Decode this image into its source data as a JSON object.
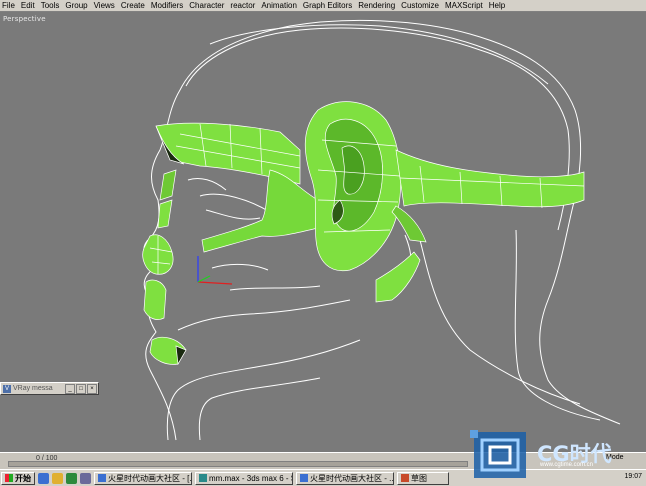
{
  "menu": [
    "File",
    "Edit",
    "Tools",
    "Group",
    "Views",
    "Create",
    "Modifiers",
    "Character",
    "reactor",
    "Animation",
    "Graph Editors",
    "Rendering",
    "Customize",
    "MAXScript",
    "Help"
  ],
  "viewport": {
    "label": "Perspective"
  },
  "vray_panel": {
    "title": "VRay messa",
    "buttons": [
      "_",
      "□",
      "×"
    ]
  },
  "timebar": {
    "frame_counter": "0 / 100",
    "snap_mode": "Mode"
  },
  "taskbar": {
    "start_label": "开始",
    "tasks": [
      {
        "label": "火星时代动画大社区 - [..."
      },
      {
        "label": "mm.max - 3ds max 6 - St..."
      },
      {
        "label": "火星时代动画大社区 - ..."
      },
      {
        "label": "草图"
      }
    ],
    "clock": "19:07"
  },
  "watermark": {
    "brand": "CG时代",
    "url": "www.cgtime.com.cn"
  },
  "colors": {
    "mesh_green": "#7fe040",
    "wire_white": "#ffffff",
    "viewport_bg": "#7a7a7a",
    "chrome": "#d4d0c8"
  }
}
